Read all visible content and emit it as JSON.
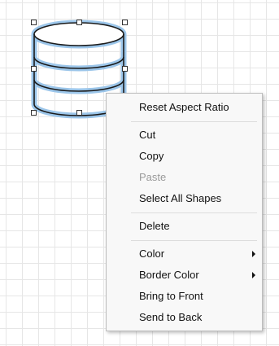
{
  "canvas": {
    "shape_icon": "cylinder-database-icon",
    "selection_color": "#5b9bd5",
    "cursor_icon": "arrow-pointer-icon"
  },
  "context_menu": {
    "reset_aspect_ratio": "Reset Aspect Ratio",
    "cut": "Cut",
    "copy": "Copy",
    "paste": "Paste",
    "select_all_shapes": "Select All Shapes",
    "delete": "Delete",
    "color": "Color",
    "border_color": "Border Color",
    "bring_to_front": "Bring to Front",
    "send_to_back": "Send to Back",
    "submenu_arrow_icon": "triangle-right-icon"
  }
}
